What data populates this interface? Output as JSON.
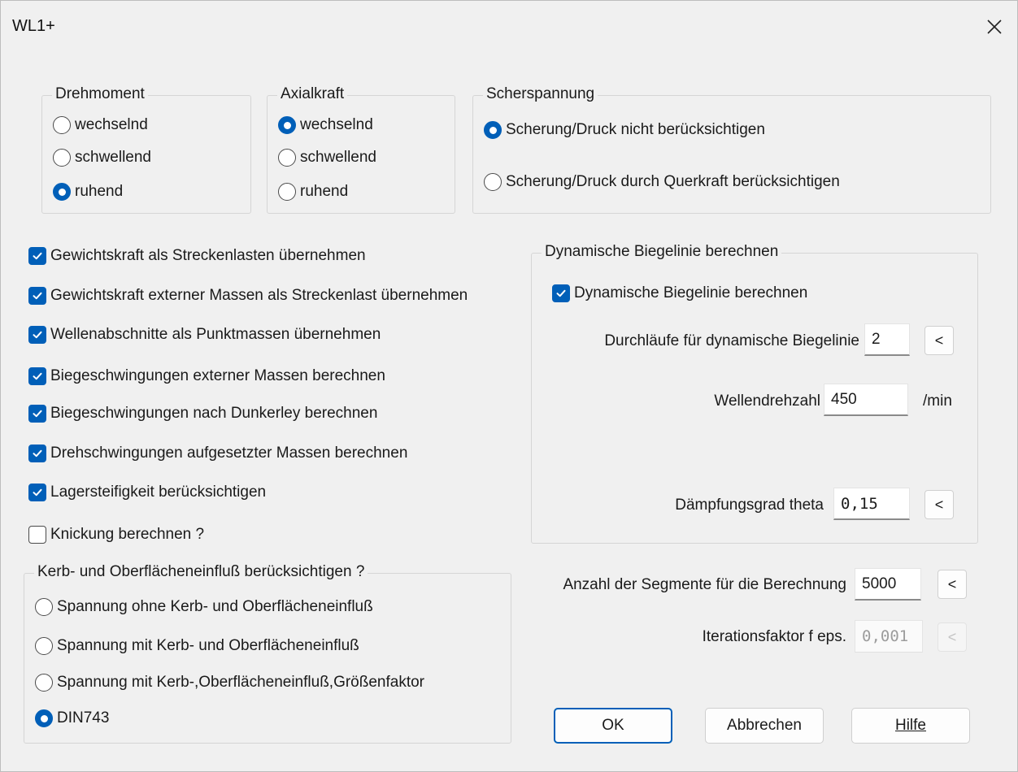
{
  "window": {
    "title": "WL1+"
  },
  "drehmoment": {
    "legend": "Drehmoment",
    "options": [
      {
        "label": "wechselnd",
        "checked": false
      },
      {
        "label": "schwellend",
        "checked": false
      },
      {
        "label": "ruhend",
        "checked": true
      }
    ]
  },
  "axialkraft": {
    "legend": "Axialkraft",
    "options": [
      {
        "label": "wechselnd",
        "checked": true
      },
      {
        "label": "schwellend",
        "checked": false
      },
      {
        "label": "ruhend",
        "checked": false
      }
    ]
  },
  "scherspannung": {
    "legend": "Scherspannung",
    "options": [
      {
        "label": "Scherung/Druck nicht berücksichtigen",
        "checked": true
      },
      {
        "label": "Scherung/Druck durch Querkraft berücksichtigen",
        "checked": false
      }
    ]
  },
  "checkboxes": [
    {
      "label": "Gewichtskraft als Streckenlasten übernehmen",
      "checked": true
    },
    {
      "label": "Gewichtskraft externer Massen als Streckenlast übernehmen",
      "checked": true
    },
    {
      "label": "Wellenabschnitte als Punktmassen übernehmen",
      "checked": true
    },
    {
      "label": "Biegeschwingungen externer Massen berechnen",
      "checked": true
    },
    {
      "label": "Biegeschwingungen nach Dunkerley berechnen",
      "checked": true
    },
    {
      "label": "Drehschwingungen aufgesetzter Massen berechnen",
      "checked": true
    },
    {
      "label": "Lagersteifigkeit berücksichtigen",
      "checked": true
    },
    {
      "label": "Knickung berechnen ?",
      "checked": false
    }
  ],
  "dynamic": {
    "legend": "Dynamische Biegelinie berechnen",
    "checkbox_label": "Dynamische Biegelinie berechnen",
    "checked": true,
    "passes_label": "Durchläufe für dynamische Biegelinie",
    "passes_value": "2",
    "speed_label": "Wellendrehzahl",
    "speed_value": "450",
    "speed_unit": "/min",
    "damping_label": "Dämpfungsgrad theta",
    "damping_value": "0,15",
    "arrow_label": "<"
  },
  "kerb": {
    "legend": "Kerb- und Oberflächeneinfluß berücksichtigen ?",
    "options": [
      {
        "label": "Spannung ohne Kerb- und Oberflächeneinfluß",
        "checked": false
      },
      {
        "label": "Spannung mit Kerb- und Oberflächeneinfluß",
        "checked": false
      },
      {
        "label": "Spannung mit Kerb-,Oberflächeneinfluß,Größenfaktor",
        "checked": false
      },
      {
        "label": "DIN743",
        "checked": true
      }
    ]
  },
  "segments": {
    "label": "Anzahl der Segmente für die Berechnung",
    "value": "5000",
    "arrow_label": "<"
  },
  "iteration": {
    "label": "Iterationsfaktor f eps.",
    "value": "0,001",
    "arrow_label": "<",
    "disabled": true
  },
  "buttons": {
    "ok": "OK",
    "cancel": "Abbrechen",
    "help": "Hilfe"
  },
  "colors": {
    "accent": "#005fb8",
    "dialog_bg": "#f0f0f0"
  },
  "icons": {
    "close": "close-icon",
    "checkmark": "checkmark-icon"
  }
}
